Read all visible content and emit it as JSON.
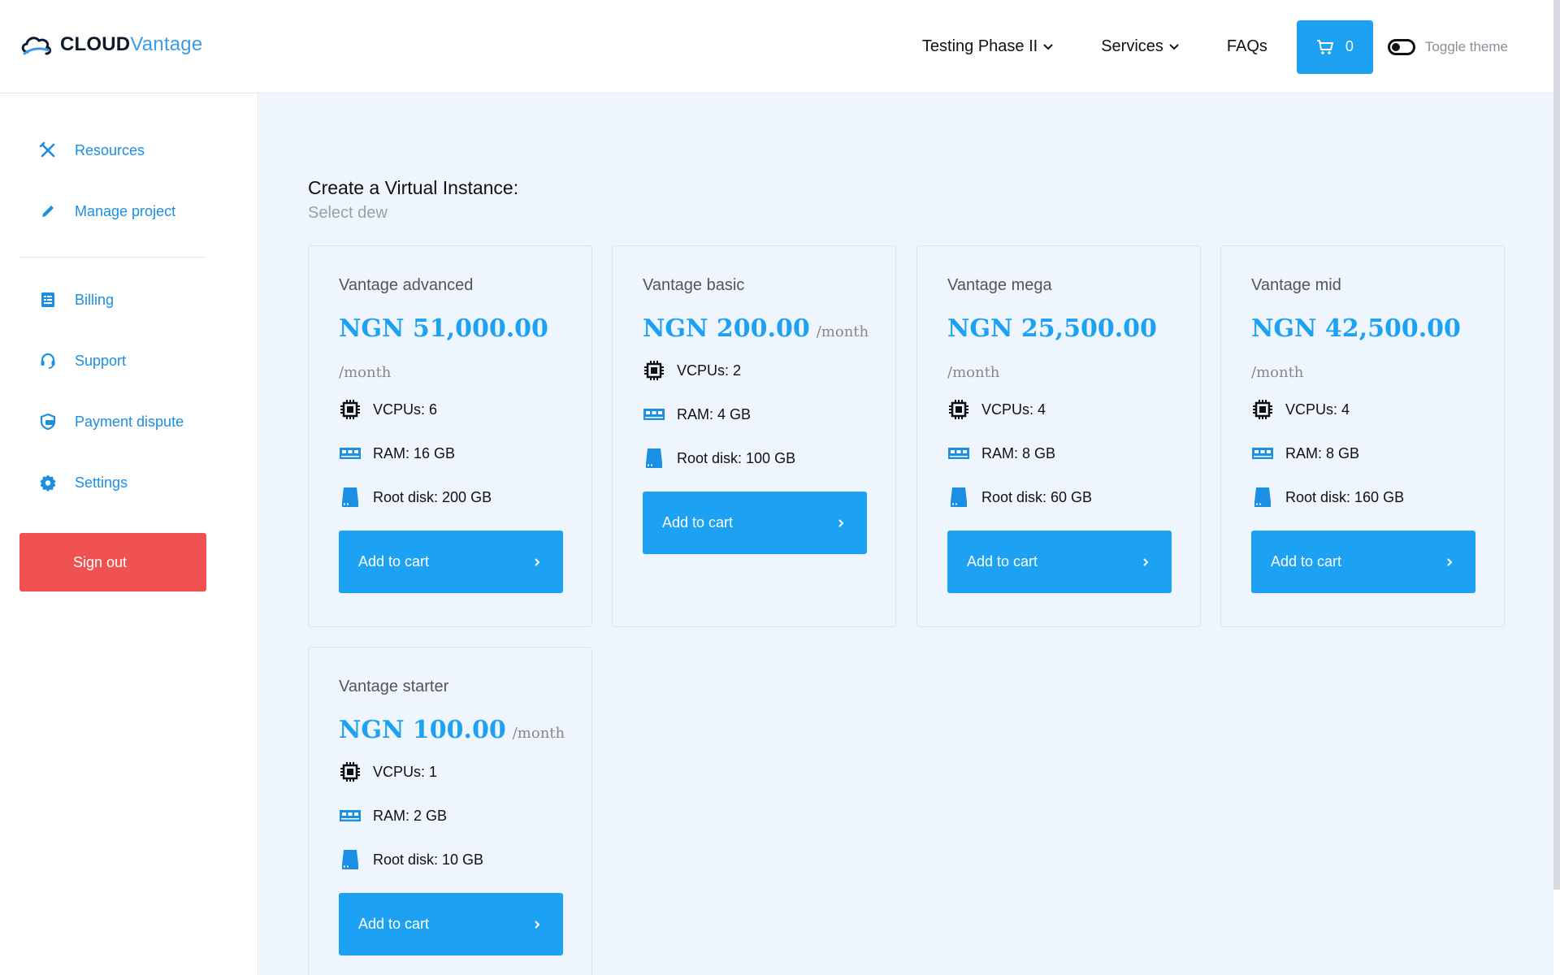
{
  "app": {
    "logo_part1": "CLOUD",
    "logo_part2": "Vantage"
  },
  "header": {
    "nav": [
      {
        "label": "Testing Phase II",
        "has_dropdown": true
      },
      {
        "label": "Services",
        "has_dropdown": true
      },
      {
        "label": "FAQs",
        "has_dropdown": false
      }
    ],
    "cart_count": "0",
    "toggle_label": "Toggle theme"
  },
  "sidebar": {
    "items": [
      {
        "label": "Resources",
        "icon": "tools-icon"
      },
      {
        "label": "Manage project",
        "icon": "pencil-icon"
      },
      {
        "label": "Billing",
        "icon": "billing-icon"
      },
      {
        "label": "Support",
        "icon": "headset-icon"
      },
      {
        "label": "Payment dispute",
        "icon": "shield-card-icon"
      },
      {
        "label": "Settings",
        "icon": "gear-icon"
      }
    ],
    "signout_label": "Sign out"
  },
  "main": {
    "title": "Create a Virtual Instance:",
    "subtitle": "Select dew",
    "per_month": "/month",
    "add_to_cart_label": "Add to cart",
    "plans": [
      {
        "name": "Vantage advanced",
        "price": "NGN 51,000.00",
        "vcpus": "VCPUs: 6",
        "ram": "RAM: 16 GB",
        "disk": "Root disk: 200 GB"
      },
      {
        "name": "Vantage basic",
        "price": "NGN 200.00",
        "vcpus": "VCPUs: 2",
        "ram": "RAM: 4 GB",
        "disk": "Root disk: 100 GB"
      },
      {
        "name": "Vantage mega",
        "price": "NGN 25,500.00",
        "vcpus": "VCPUs: 4",
        "ram": "RAM: 8 GB",
        "disk": "Root disk: 60 GB"
      },
      {
        "name": "Vantage mid",
        "price": "NGN 42,500.00",
        "vcpus": "VCPUs: 4",
        "ram": "RAM: 8 GB",
        "disk": "Root disk: 160 GB"
      },
      {
        "name": "Vantage starter",
        "price": "NGN 100.00",
        "vcpus": "VCPUs: 1",
        "ram": "RAM: 2 GB",
        "disk": "Root disk: 10 GB"
      }
    ]
  },
  "colors": {
    "accent": "#1da1f2",
    "sidebar_link": "#1a8fe3",
    "danger": "#f05252",
    "main_bg": "#eef5fd"
  }
}
